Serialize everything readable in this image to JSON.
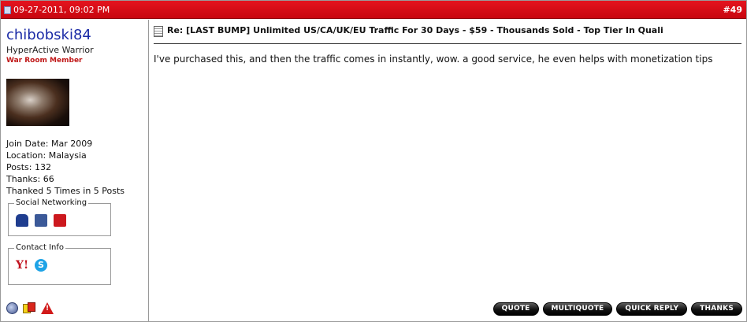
{
  "header": {
    "date": "09-27-2011, 09:02 PM",
    "post_number": "#49"
  },
  "user": {
    "name": "chibobski84",
    "title": "HyperActive Warrior",
    "rank": "War Room Member",
    "stats": [
      "Join Date: Mar 2009",
      "Location: Malaysia",
      "Posts: 132",
      "Thanks: 66",
      "Thanked 5 Times in 5 Posts"
    ],
    "social_legend": "Social Networking",
    "social_icons": [
      "myspace-icon",
      "facebook-icon",
      "youtube-icon"
    ],
    "contact_legend": "Contact Info",
    "contact_icons": [
      "yahoo-icon",
      "skype-icon"
    ],
    "status_icons": [
      "online-status-icon",
      "warning-cards-icon",
      "report-post-icon"
    ]
  },
  "post": {
    "title": "Re: [LAST BUMP] Unlimited US/CA/UK/EU Traffic For 30 Days - $59 - Thousands Sold - Top Tier In Quali",
    "message": "I've purchased this, and then the traffic comes in instantly, wow. a good service, he even helps with monetization tips"
  },
  "buttons": {
    "quote": "QUOTE",
    "multiquote": "MULTIQUOTE",
    "quick_reply": "QUICK REPLY",
    "thanks": "THANKS"
  },
  "colors": {
    "header_red": "#d40a14",
    "username_blue": "#1a2aa6",
    "rank_red": "#c01818"
  }
}
